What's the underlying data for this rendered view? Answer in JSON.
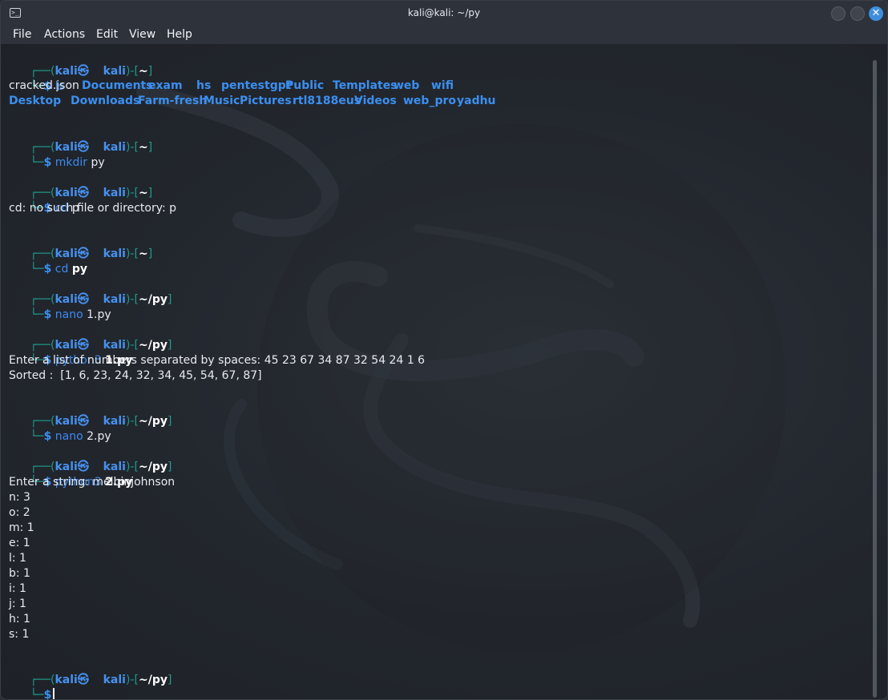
{
  "window": {
    "title": "kali@kali: ~/py",
    "close_glyph": "✕",
    "app_icon_glyph": ">_"
  },
  "menu": {
    "file": "File",
    "actions": "Actions",
    "edit": "Edit",
    "view": "View",
    "help": "Help"
  },
  "prompt": {
    "corner_top": "┌──(",
    "user": "kali",
    "skull": "㉿",
    "host": "kali",
    "mid": ")-[",
    "close": "]",
    "corner_bottom": "└─",
    "dollar": "$"
  },
  "blocks": [
    {
      "path": "~",
      "cmd": "ls",
      "arg": ""
    },
    {
      "path": "~",
      "cmd": "mkdir",
      "arg": "py"
    },
    {
      "path": "~",
      "cmd": "cd",
      "arg": "p"
    },
    {
      "path": "~",
      "cmd": "cd",
      "arg": "py"
    },
    {
      "path": "~/py",
      "cmd": "nano",
      "arg": "1.py"
    },
    {
      "path": "~/py",
      "cmd": "python3",
      "arg": "1.py"
    },
    {
      "path": "~/py",
      "cmd": "nano",
      "arg": "2.py"
    },
    {
      "path": "~/py",
      "cmd": "python3",
      "arg": "2.py"
    },
    {
      "path": "~/py",
      "cmd": "",
      "arg": ""
    }
  ],
  "ls_output": {
    "row1": [
      "cracked.json",
      "Documents",
      "exam",
      "hs",
      "pentestgpt",
      "Public",
      "Templates",
      "web",
      "wifi"
    ],
    "row2": [
      "Desktop",
      "Downloads",
      "Farm-fresh",
      "Music",
      "Pictures",
      "rtl8188eus",
      "Videos",
      "web_pro",
      "yadhu"
    ]
  },
  "output": {
    "cd_error": "cd: no such file or directory: p",
    "sort_prompt": "Enter a list of numbers separated by spaces: 45 23 67 34 87 32 54 24 1 6",
    "sorted": "Sorted :  [1, 6, 23, 24, 32, 34, 45, 54, 67, 87]",
    "string_prompt": "Enter a string: melbinjohnson",
    "counts": [
      "n: 3",
      "o: 2",
      "m: 1",
      "e: 1",
      "l: 1",
      "b: 1",
      "i: 1",
      "j: 1",
      "h: 1",
      "s: 1"
    ]
  },
  "colors": {
    "accent": "#3b8ff0",
    "bracket": "#1f9b8c",
    "background": "#22262d",
    "close_button": "#3d8ee0"
  }
}
